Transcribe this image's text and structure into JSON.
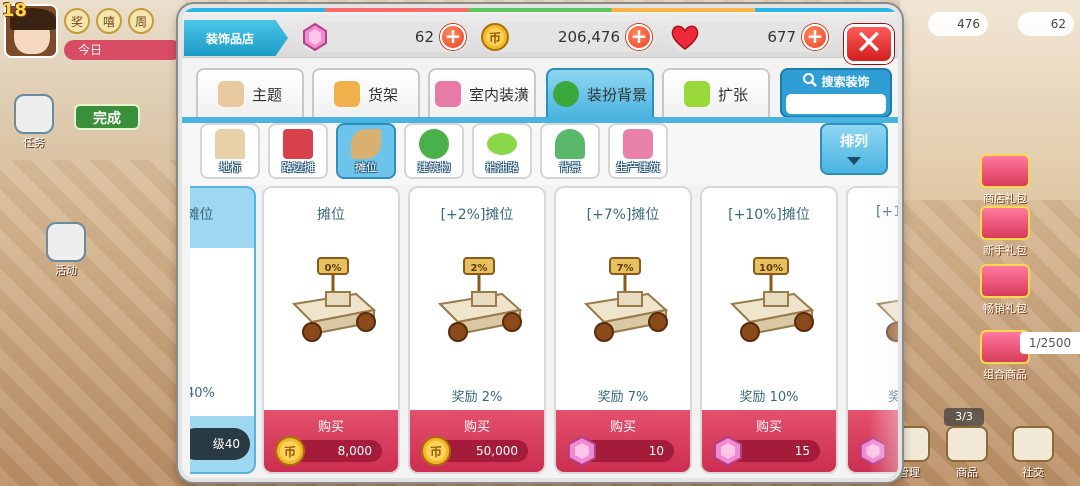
{
  "hud": {
    "level": "18",
    "today_label": "今日",
    "circle1": "奖",
    "circle2": "嘻",
    "circle3": "周",
    "task_label": "任务",
    "complete_label": "完成",
    "activity_label": "活动",
    "right_coins": "476",
    "right_gems": "62",
    "gift1": "商店礼包",
    "gift2": "新手礼包",
    "gift3": "畅销礼包",
    "combo_label": "组合商品",
    "score_tag": "1/2500",
    "page_tag": "3/3",
    "btn_manage": "管理",
    "btn_goods": "商品",
    "btn_social": "社交"
  },
  "dialog": {
    "shop_tab": "装饰品店",
    "gems": "62",
    "coins": "206,476",
    "hearts": "677",
    "close_label": "✕",
    "tabs": [
      {
        "label": "主题",
        "icon_color": "#e8c9a0"
      },
      {
        "label": "货架",
        "icon_color": "#f0b04a"
      },
      {
        "label": "室内装潢",
        "icon_color": "#e87aa8"
      },
      {
        "label": "装扮背景",
        "icon_color": "#3aa83a"
      },
      {
        "label": "扩张",
        "icon_color": "#9ad83a"
      }
    ],
    "search_label": "搜索装饰",
    "search_placeholder": "",
    "subcats": [
      {
        "label": "地标",
        "icon_color": "#e8d0a8"
      },
      {
        "label": "路边摊",
        "icon_color": "#d8404a"
      },
      {
        "label": "摊位",
        "icon_color": "#d8b070"
      },
      {
        "label": "建筑物",
        "icon_color": "#4ab04a"
      },
      {
        "label": "柏油路",
        "icon_color": "#8ad84a"
      },
      {
        "label": "背景",
        "icon_color": "#5ab86a"
      },
      {
        "label": "生产建筑",
        "icon_color": "#e880a8"
      }
    ],
    "sort_label": "排列",
    "cards": [
      {
        "title": "]摊位",
        "reward": "40%",
        "level": "级40",
        "partial": true
      },
      {
        "title": "摊位",
        "reward": "",
        "buy": "购买",
        "price": "8,000",
        "currency": "coin",
        "badge": "0%"
      },
      {
        "title": "[+2%]摊位",
        "reward": "奖励 2%",
        "buy": "购买",
        "price": "50,000",
        "currency": "coin",
        "badge": "2%"
      },
      {
        "title": "[+7%]摊位",
        "reward": "奖励 7%",
        "buy": "购买",
        "price": "10",
        "currency": "gem",
        "badge": "7%"
      },
      {
        "title": "[+10%]摊位",
        "reward": "奖励 10%",
        "buy": "购买",
        "price": "15",
        "currency": "gem",
        "badge": "10%"
      },
      {
        "title": "[+1",
        "reward": "奖",
        "currency": "gem",
        "badge": ""
      }
    ]
  },
  "colors": {
    "accent_blue": "#4ab4e0",
    "buy_red": "#cc2e50",
    "close_red": "#d31e1e"
  }
}
